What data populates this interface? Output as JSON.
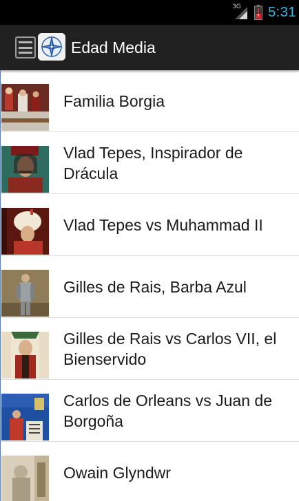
{
  "status_bar": {
    "network": "3G",
    "time": "5:31"
  },
  "action_bar": {
    "title": "Edad Media",
    "menu_icon": "drawer-menu-icon",
    "logo_icon": "compass-rose-icon"
  },
  "items": [
    {
      "label": "Familia Borgia",
      "thumb": "portrait-thumbnail"
    },
    {
      "label": "Vlad Tepes, Inspirador de Drácula",
      "thumb": "portrait-thumbnail"
    },
    {
      "label": "Vlad Tepes vs Muhammad II",
      "thumb": "portrait-thumbnail"
    },
    {
      "label": "Gilles de Rais, Barba Azul",
      "thumb": "portrait-thumbnail"
    },
    {
      "label": "Gilles de Rais vs Carlos VII, el Bienservido",
      "thumb": "portrait-thumbnail"
    },
    {
      "label": "Carlos de Orleans vs Juan de Borgoña",
      "thumb": "portrait-thumbnail"
    },
    {
      "label": "Owain Glyndwr",
      "thumb": "portrait-thumbnail"
    }
  ],
  "colors": {
    "accent": "#33b5e5",
    "action_bar": "#212121",
    "status_bar": "#000000"
  }
}
